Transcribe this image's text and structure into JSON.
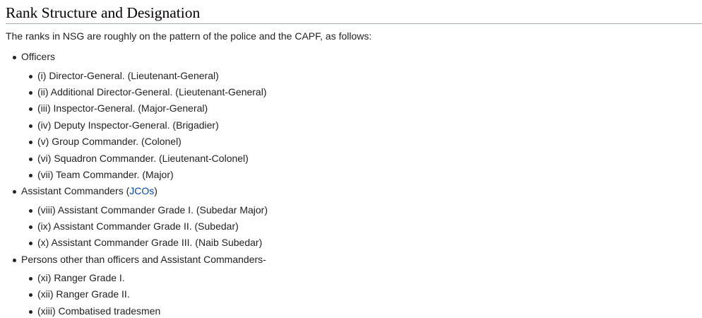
{
  "section": {
    "heading": "Rank Structure and Designation",
    "intro": "The ranks in NSG are roughly on the pattern of the police and the CAPF, as follows:"
  },
  "groups": [
    {
      "label": "Officers",
      "items": [
        "(i) Director-General. (Lieutenant-General)",
        "(ii) Additional Director-General. (Lieutenant-General)",
        "(iii) Inspector-General. (Major-General)",
        "(iv) Deputy Inspector-General. (Brigadier)",
        "(v) Group Commander. (Colonel)",
        "(vi) Squadron Commander. (Lieutenant-Colonel)",
        "(vii) Team Commander. (Major)"
      ]
    },
    {
      "label_before": "Assistant Commanders (",
      "label_link": "JCOs",
      "label_after": ")",
      "items": [
        "(viii) Assistant Commander Grade I. (Subedar Major)",
        "(ix) Assistant Commander Grade II. (Subedar)",
        "(x) Assistant Commander Grade III. (Naib Subedar)"
      ]
    },
    {
      "label": "Persons other than officers and Assistant Commanders-",
      "items": [
        "(xi) Ranger Grade I.",
        "(xii) Ranger Grade II.",
        "(xiii) Combatised tradesmen"
      ]
    }
  ],
  "colors": {
    "text": "#222222",
    "heading": "#000000",
    "link": "#0645ad",
    "rule": "#a2a9b1"
  }
}
